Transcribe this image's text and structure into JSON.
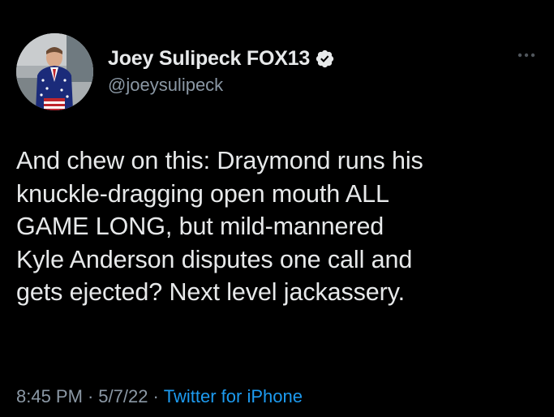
{
  "tweet": {
    "author": {
      "display_name": "Joey Sulipeck FOX13",
      "handle": "@joeysulipeck",
      "verified": true,
      "avatar_icon": "profile-photo"
    },
    "text": "And chew on this:  Draymond runs his\nknuckle-dragging open mouth ALL\nGAME LONG, but mild-mannered\nKyle Anderson disputes one call and\ngets ejected?  Next level jackassery.",
    "time": "8:45 PM",
    "separator": "·",
    "date": "5/7/22",
    "source": "Twitter for iPhone",
    "more_icon": "more-horizontal-icon"
  },
  "colors": {
    "background": "#000000",
    "text_primary": "#e7e9ea",
    "text_secondary": "#8b98a5",
    "link": "#1d9bf0",
    "verified_badge": "#e7e9ea"
  }
}
